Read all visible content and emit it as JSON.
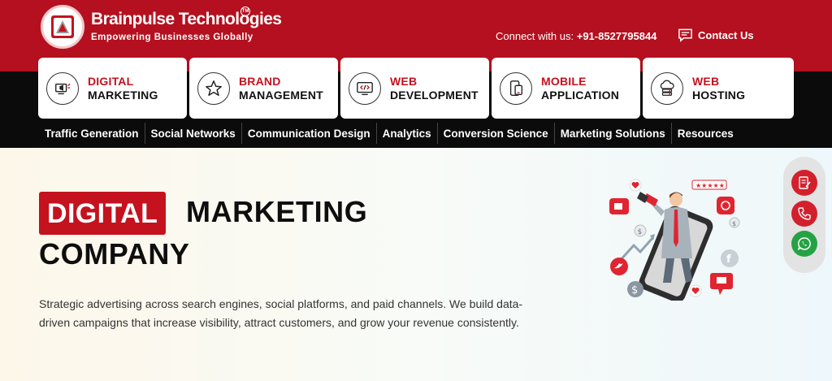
{
  "header": {
    "logo_name": "Brainpulse Technologies",
    "logo_tm": "TM",
    "logo_tagline": "Empowering Businesses Globally",
    "connect_label": "Connect with us:",
    "phone": "+91-8527795844",
    "contact_label": "Contact Us"
  },
  "services": [
    {
      "line1": "DIGITAL",
      "line2": "MARKETING",
      "icon": "digital-marketing-icon"
    },
    {
      "line1": "BRAND",
      "line2": "MANAGEMENT",
      "icon": "star-icon"
    },
    {
      "line1": "WEB",
      "line2": "DEVELOPMENT",
      "icon": "code-monitor-icon"
    },
    {
      "line1": "MOBILE",
      "line2": "APPLICATION",
      "icon": "mobile-icon"
    },
    {
      "line1": "WEB",
      "line2": "HOSTING",
      "icon": "cloud-hosting-icon"
    }
  ],
  "subnav": [
    "Traffic Generation",
    "Social Networks",
    "Communication Design",
    "Analytics",
    "Conversion Science",
    "Marketing Solutions",
    "Resources"
  ],
  "hero": {
    "badge": "DIGITAL",
    "title_rest": "MARKETING",
    "title_line2": "COMPANY",
    "description": "Strategic advertising across search engines, social platforms, and paid channels. We build data-driven campaigns that increase visibility, attract customers, and grow your revenue consistently."
  },
  "rail": {
    "icons": [
      "form-icon",
      "phone-icon",
      "whatsapp-icon"
    ]
  },
  "colors": {
    "brand_red": "#b5101f",
    "accent_red": "#c4121f",
    "nav_black": "#0b0b0b",
    "whatsapp_green": "#25a244"
  }
}
